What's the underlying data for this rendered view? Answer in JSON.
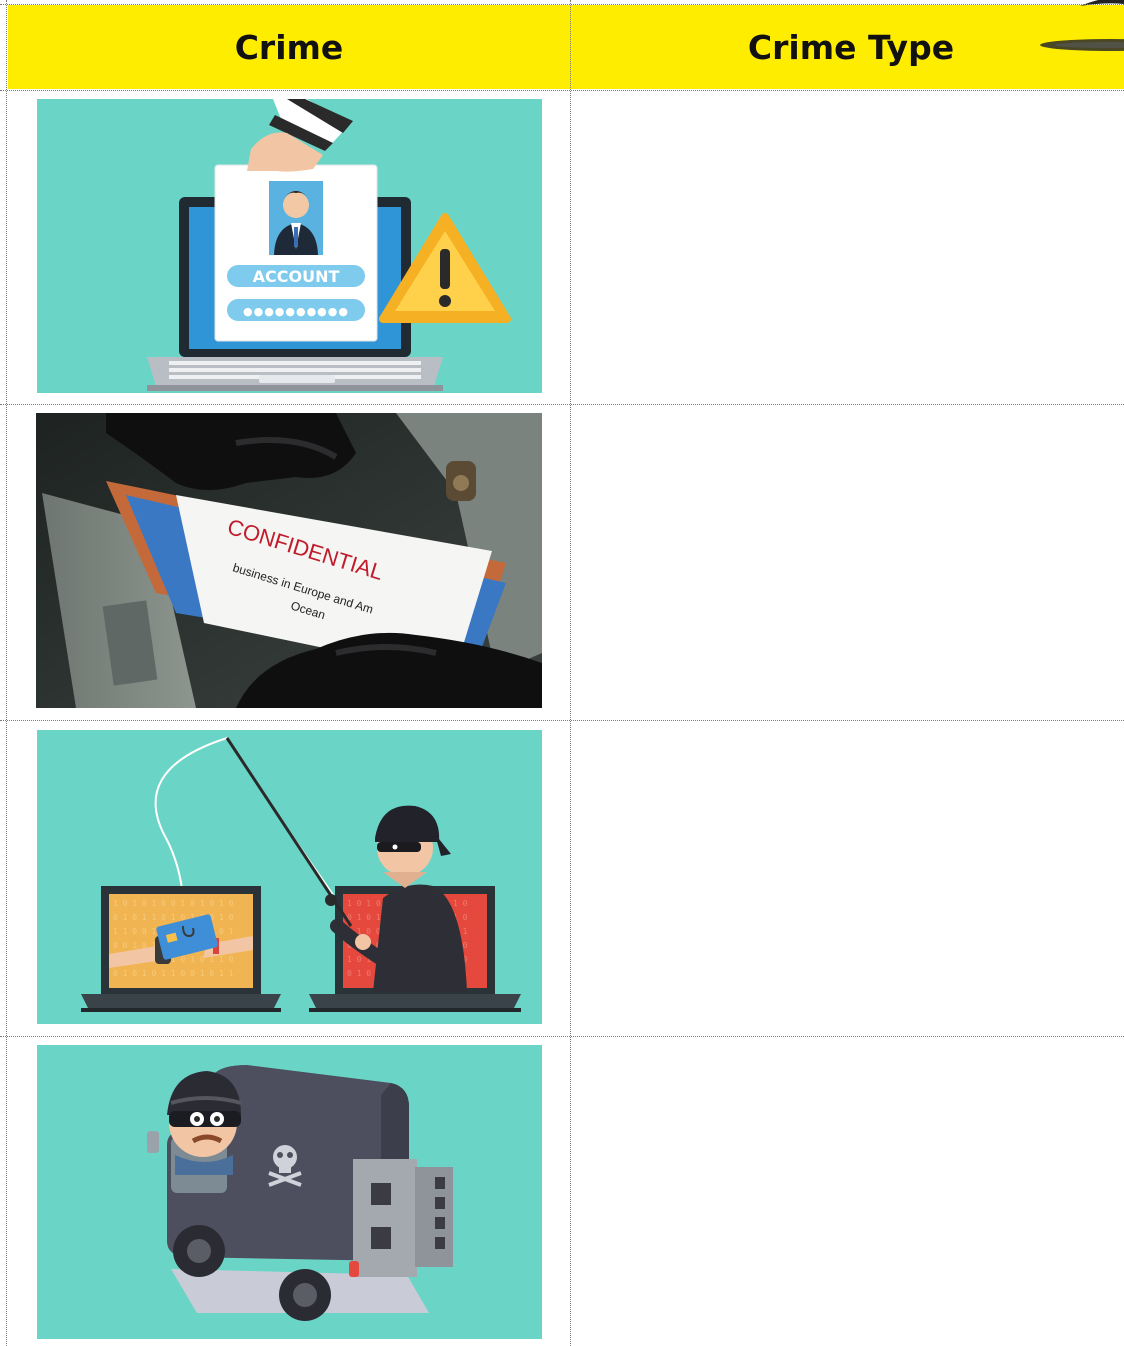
{
  "table": {
    "headers": {
      "crime": "Crime",
      "crime_type": "Crime Type"
    },
    "rows": [
      {
        "image_text": [
          "ACCOUNT",
          "●●●●●●●●●●"
        ],
        "answer": ""
      },
      {
        "image_text": [
          "CONFIDENTIAL",
          "business in Europe and Am",
          "Ocean"
        ],
        "answer": ""
      },
      {
        "image_text": [],
        "answer": ""
      },
      {
        "image_text": [],
        "answer": ""
      }
    ]
  },
  "colors": {
    "header_bg": "#ffed00",
    "teal": "#6ad5c7",
    "border": "#7a7a7a"
  }
}
